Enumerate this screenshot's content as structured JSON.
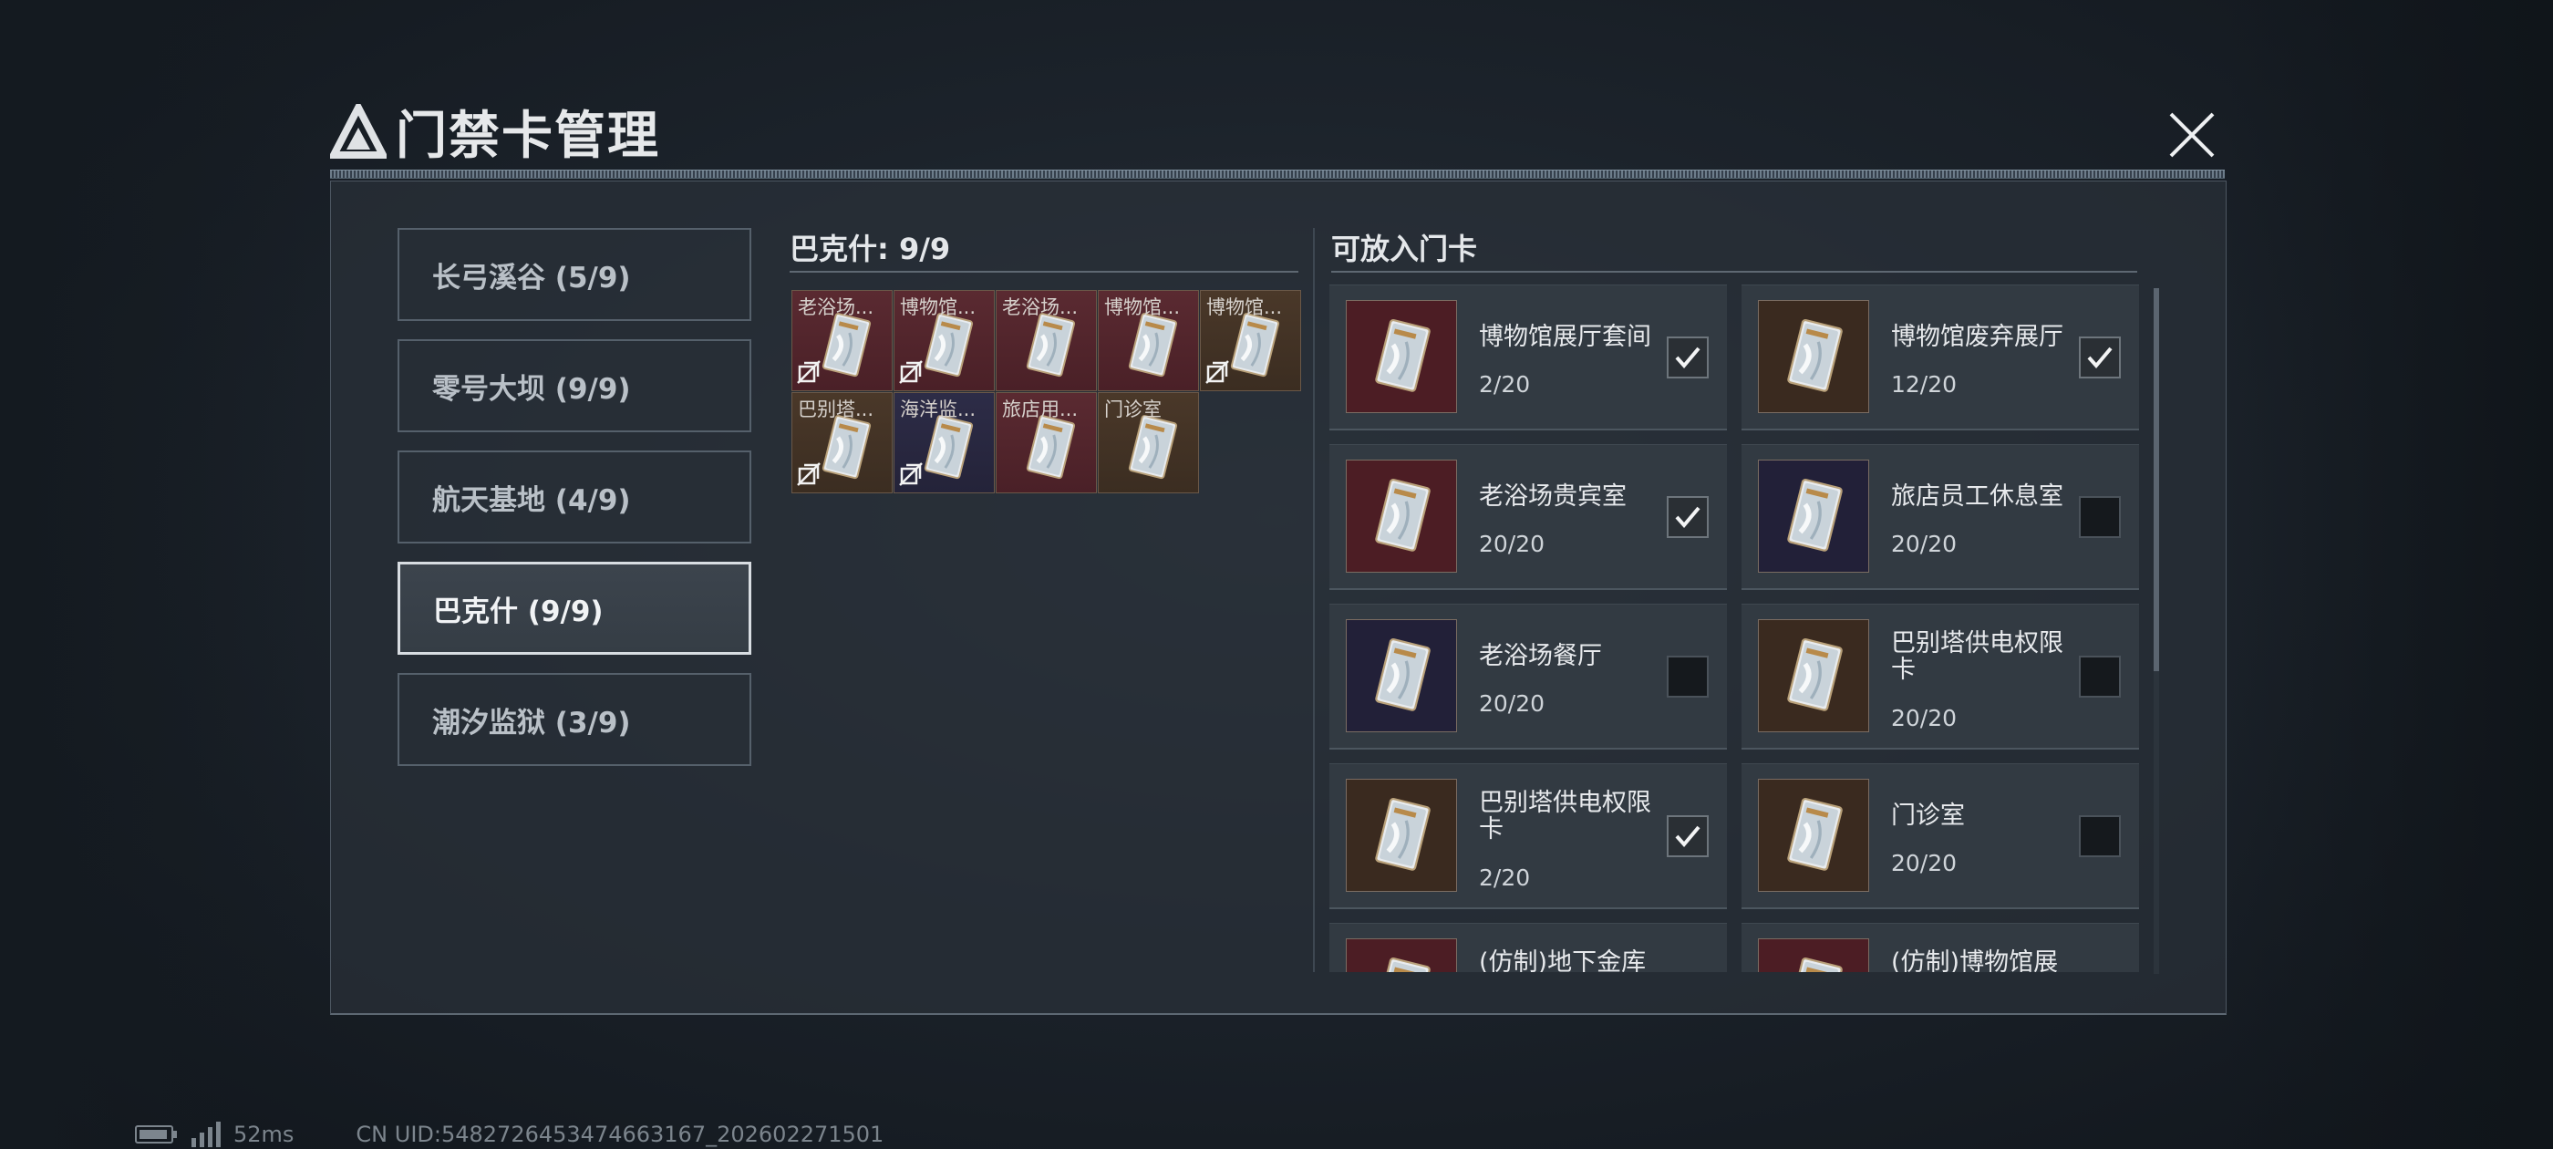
{
  "header": {
    "title": "门禁卡管理",
    "close_label": "✕"
  },
  "regions": [
    {
      "label": "长弓溪谷 (5/9)",
      "active": false
    },
    {
      "label": "零号大坝 (9/9)",
      "active": false
    },
    {
      "label": "航天基地 (4/9)",
      "active": false
    },
    {
      "label": "巴克什 (9/9)",
      "active": true
    },
    {
      "label": "潮汐监狱 (3/9)",
      "active": false
    }
  ],
  "assigned": {
    "title": "巴克什: 9/9",
    "slots": [
      {
        "label": "老浴场...",
        "color": "red",
        "locked": true
      },
      {
        "label": "博物馆...",
        "color": "red",
        "locked": true
      },
      {
        "label": "老浴场...",
        "color": "red",
        "locked": false
      },
      {
        "label": "博物馆...",
        "color": "red",
        "locked": false
      },
      {
        "label": "博物馆...",
        "color": "brown",
        "locked": true
      },
      {
        "label": "巴别塔...",
        "color": "brown",
        "locked": true
      },
      {
        "label": "海洋监...",
        "color": "navy",
        "locked": true
      },
      {
        "label": "旅店用...",
        "color": "red",
        "locked": false
      },
      {
        "label": "门诊室",
        "color": "brown",
        "locked": false
      }
    ]
  },
  "available": {
    "title": "可放入门卡",
    "cards": [
      {
        "name": "博物馆展厅套间",
        "count": "2/20",
        "color": "red",
        "checked": true
      },
      {
        "name": "博物馆废弃展厅",
        "count": "12/20",
        "color": "brown",
        "checked": true
      },
      {
        "name": "老浴场贵宾室",
        "count": "20/20",
        "color": "red",
        "checked": true
      },
      {
        "name": "旅店员工休息室",
        "count": "20/20",
        "color": "navy",
        "checked": false
      },
      {
        "name": "老浴场餐厅",
        "count": "20/20",
        "color": "navy",
        "checked": false
      },
      {
        "name": "巴别塔供电权限卡",
        "count": "20/20",
        "color": "brown",
        "checked": false
      },
      {
        "name": "巴别塔供电权限卡",
        "count": "2/20",
        "color": "brown",
        "checked": true
      },
      {
        "name": "门诊室",
        "count": "20/20",
        "color": "brown",
        "checked": false
      },
      {
        "name": "(仿制)地下金库",
        "count": "",
        "color": "red",
        "checked": false
      },
      {
        "name": "(仿制)博物馆展",
        "count": "",
        "color": "red",
        "checked": false
      }
    ]
  },
  "footer": {
    "ping": "52ms",
    "uid": "CN UID:5482726453474663167_202602271501"
  },
  "colors": {
    "accent": "#d8dde2",
    "card_red": "#4c1d24",
    "card_brown": "#3a2a1f",
    "card_navy": "#222038"
  }
}
